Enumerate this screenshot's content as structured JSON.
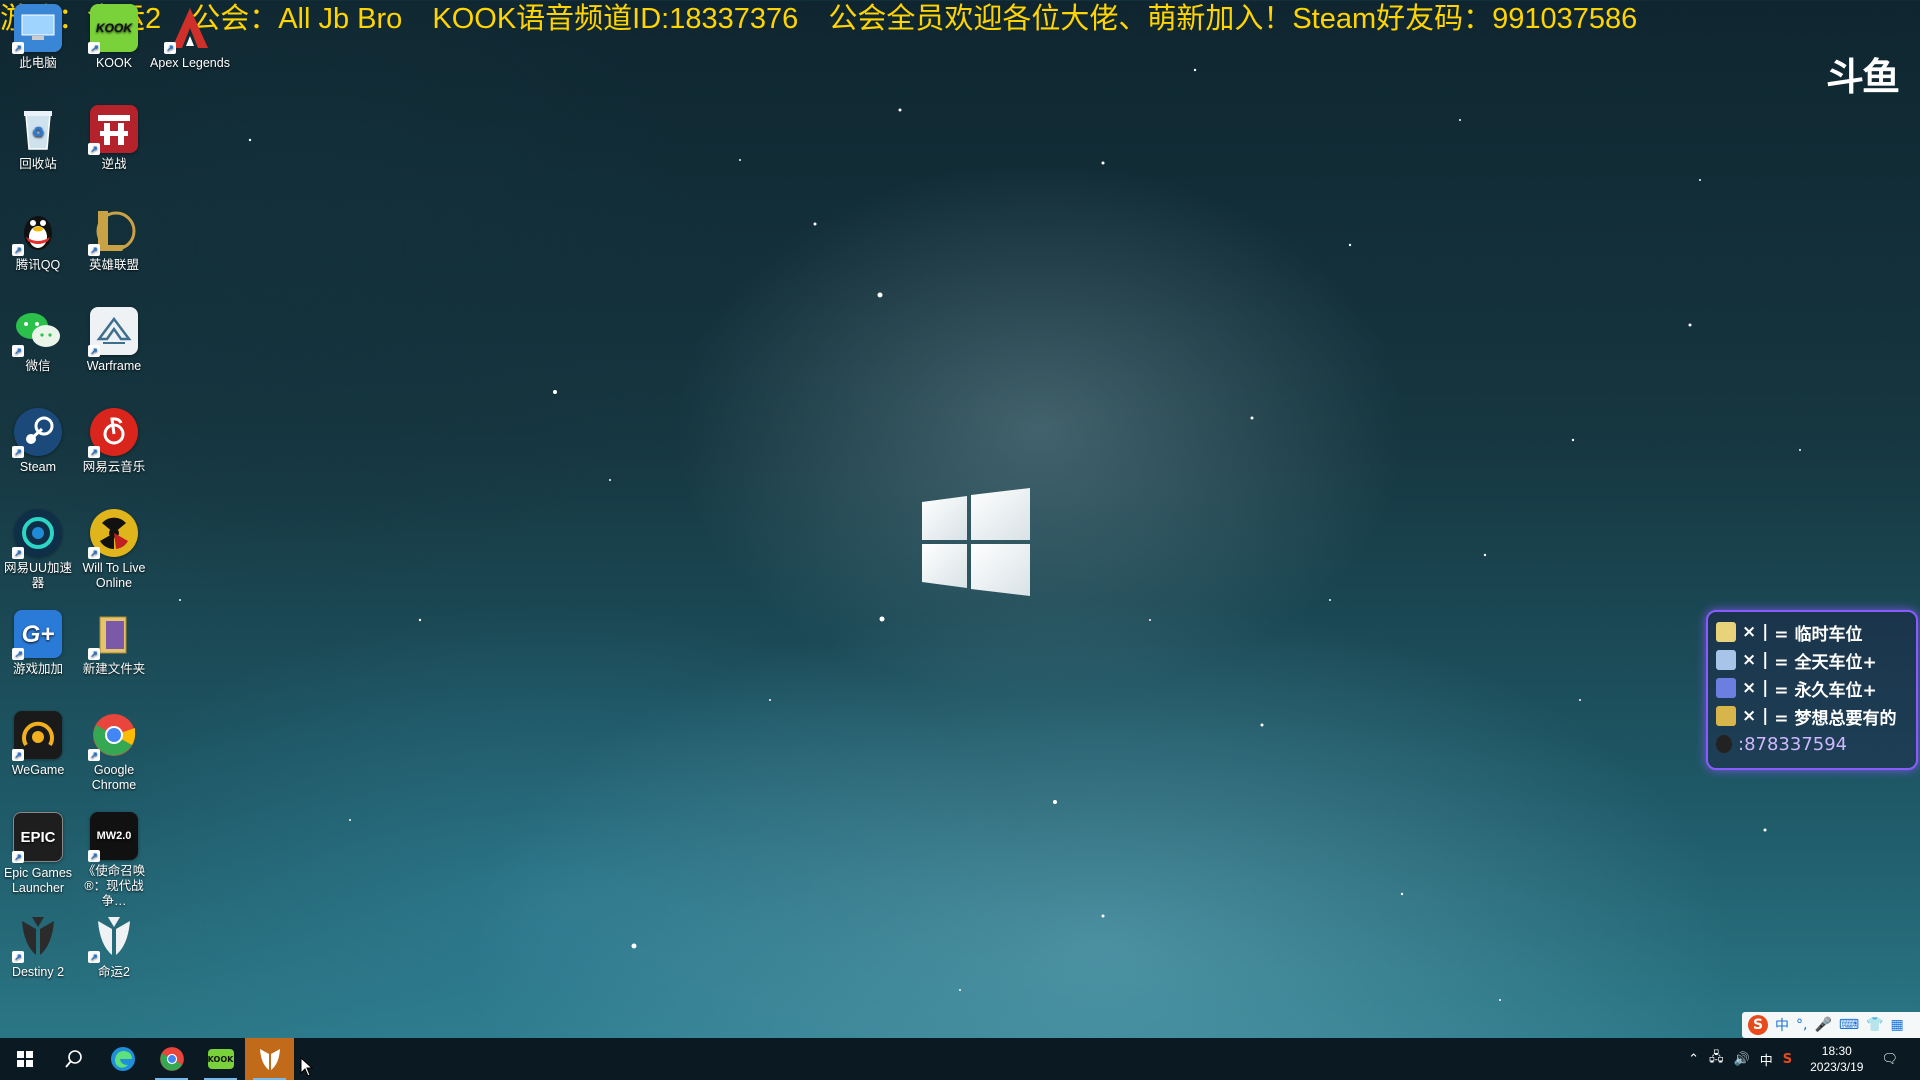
{
  "stream_marquee": {
    "segments": [
      "游戏：命运2",
      "公会：All Jb Bro",
      "KOOK语音频道ID:18337376",
      "公会全员欢迎各位大佬、萌新加入！Steam好友码：991037586"
    ]
  },
  "platform_watermark": "斗鱼",
  "desktop_icons": [
    {
      "label": "此电脑",
      "icon": "this-pc-icon",
      "color": "#3a86d6"
    },
    {
      "label": "KOOK",
      "icon": "kook-icon",
      "color": "#7ad23a"
    },
    {
      "label": "Apex Legends",
      "icon": "apex-legends-icon",
      "color": "#c8302a"
    },
    {
      "label": "回收站",
      "icon": "recycle-bin-icon",
      "color": "#9fb7c9"
    },
    {
      "label": "逆战",
      "icon": "nizhan-icon",
      "color": "#b4232c"
    },
    {
      "label": "腾讯QQ",
      "icon": "qq-icon",
      "color": "#1d1d1d"
    },
    {
      "label": "英雄联盟",
      "icon": "league-of-legends-icon",
      "color": "#c9a246"
    },
    {
      "label": "微信",
      "icon": "wechat-icon",
      "color": "#2bc04a"
    },
    {
      "label": "Warframe",
      "icon": "warframe-icon",
      "color": "#e9eef2"
    },
    {
      "label": "Steam",
      "icon": "steam-icon",
      "color": "#1b2838"
    },
    {
      "label": "网易云音乐",
      "icon": "netease-music-icon",
      "color": "#d9251c"
    },
    {
      "label": "网易UU加速器",
      "icon": "uu-accelerator-icon",
      "color": "#1f8bd6"
    },
    {
      "label": "Will To Live Online",
      "icon": "will-to-live-icon",
      "color": "#e0b51c"
    },
    {
      "label": "游戏加加",
      "icon": "game-plus-icon",
      "color": "#2a7ad8"
    },
    {
      "label": "新建文件夹",
      "icon": "folder-icon",
      "color": "#e6c46a"
    },
    {
      "label": "WeGame",
      "icon": "wegame-icon",
      "color": "#202020"
    },
    {
      "label": "Google Chrome",
      "icon": "chrome-icon",
      "color": "#e8453c"
    },
    {
      "label": "Epic Games Launcher",
      "icon": "epic-games-icon",
      "color": "#2a2a2a"
    },
    {
      "label": "《使命召唤®：现代战争…",
      "icon": "cod-mw2-icon",
      "color": "#1a1a1a"
    },
    {
      "label": "Destiny 2",
      "icon": "destiny2-icon",
      "color": "#2b2b2b"
    },
    {
      "label": "命运2",
      "icon": "destiny2-tricorn-icon",
      "color": "#e7ecef"
    }
  ],
  "desk_icon_text": {
    "kook": "KOOK",
    "epic": "EPIC",
    "mw2": "MW2.0"
  },
  "stream_overlay": {
    "rows": [
      {
        "mult": "× |",
        "text": "= 临时车位"
      },
      {
        "mult": "× |",
        "text": "= 全天车位+"
      },
      {
        "mult": "× |",
        "text": "= 永久车位+"
      },
      {
        "mult": "× |",
        "text": "= 梦想总要有的"
      }
    ],
    "qq_number": ":878337594"
  },
  "ime_bar": {
    "logo": "S",
    "mode": "中",
    "punct": "°,"
  },
  "taskbar": {
    "apps": [
      {
        "name": "start-button",
        "icon": "windows-start-icon"
      },
      {
        "name": "search-button",
        "icon": "search-icon"
      },
      {
        "name": "edge-button",
        "icon": "edge-icon"
      },
      {
        "name": "chrome-button",
        "icon": "chrome-icon"
      },
      {
        "name": "kook-button",
        "icon": "kook-icon"
      },
      {
        "name": "destiny2-button",
        "icon": "destiny2-tricorn-icon"
      }
    ],
    "kook_text": "KOOK",
    "tray": {
      "ime_indicator": "中",
      "time": "18:30",
      "date": "2023/3/19"
    }
  },
  "colors": {
    "marquee": "#ffd400",
    "overlay_border": "#8a5cff",
    "taskbar": "#0b1a22",
    "active_app": "#c06a1a"
  }
}
